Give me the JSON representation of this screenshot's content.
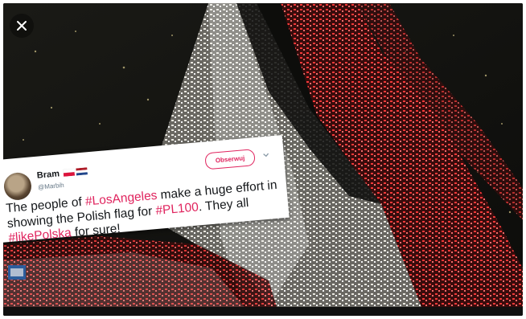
{
  "viewer": {
    "close_icon": "close-icon"
  },
  "tweet": {
    "author_name": "Bram",
    "author_handle": "@Marbih",
    "flags": [
      "flag-poland",
      "flag-netherlands"
    ],
    "follow_label": "Obserwuj",
    "caret_icon": "chevron-down-icon",
    "text": {
      "t1": "The people of ",
      "h1": "#LosAngeles",
      "t2": " make a huge effort in showing the Polish flag for ",
      "h2": "#PL100",
      "t3": ". They all ",
      "h3": "#likePolska",
      "t4": " for sure!"
    }
  },
  "colors": {
    "hashtag": "#e0245e",
    "text": "#14171a",
    "handle": "#657786"
  }
}
